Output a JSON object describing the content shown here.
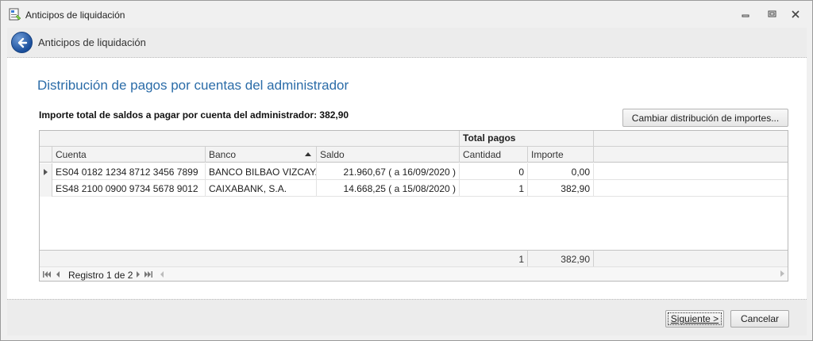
{
  "window": {
    "title": "Anticipos de liquidación",
    "icons": {
      "app": "app-document-icon",
      "minimize": "minimize-icon",
      "maximize": "maximize-icon",
      "close": "close-icon"
    }
  },
  "header": {
    "title": "Anticipos de liquidación",
    "back_icon": "back-arrow-icon"
  },
  "content": {
    "section_title": "Distribución de pagos por cuentas del administrador",
    "total_label": "Importe total de saldos a pagar por cuenta del administrador: 382,90",
    "change_button": "Cambiar distribución de importes..."
  },
  "grid": {
    "band_header": "Total pagos",
    "columns": [
      "Cuenta",
      "Banco",
      "Saldo",
      "Cantidad",
      "Importe"
    ],
    "sorted_column": "Banco",
    "rows": [
      {
        "cuenta": "ES04 0182 1234 8712 3456 7899",
        "banco": "BANCO BILBAO VIZCAYA...",
        "saldo": "21.960,67 ( a 16/09/2020 )",
        "cantidad": "0",
        "importe": "0,00"
      },
      {
        "cuenta": "ES48 2100 0900 9734 5678 9012",
        "banco": "CAIXABANK, S.A.",
        "saldo": "14.668,25 ( a 15/08/2020 )",
        "cantidad": "1",
        "importe": "382,90"
      }
    ],
    "footer": {
      "cantidad": "1",
      "importe": "382,90"
    },
    "navigator": {
      "label": "Registro 1 de 2"
    }
  },
  "buttons": {
    "next": "Siguiente >",
    "cancel": "Cancelar"
  },
  "colors": {
    "accent": "#2b6ca8",
    "back_button": "#1b4f9b"
  }
}
